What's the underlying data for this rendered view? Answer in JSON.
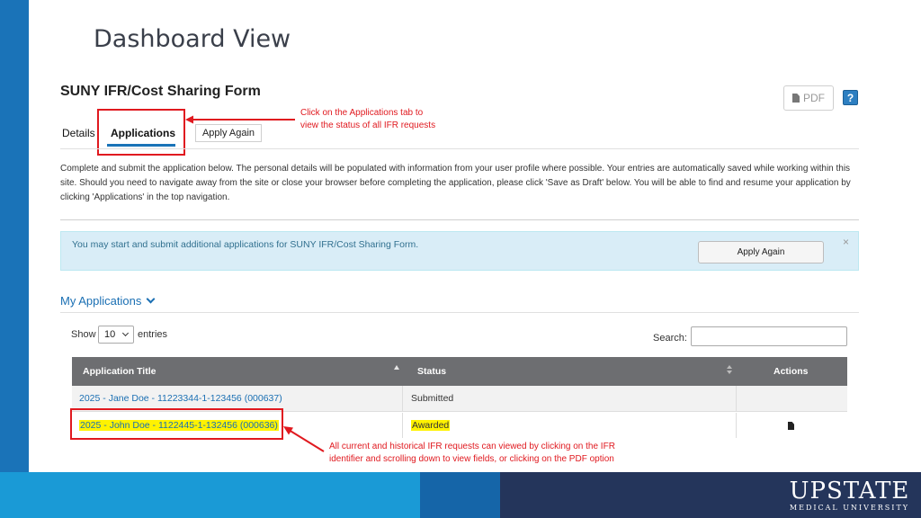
{
  "slide": {
    "title": "Dashboard View"
  },
  "form": {
    "title": "SUNY IFR/Cost Sharing Form",
    "pdf_label": "PDF",
    "help_label": "?"
  },
  "tabs": [
    {
      "label": "Details"
    },
    {
      "label": "Applications"
    }
  ],
  "apply_again_label": "Apply Again",
  "annotations": {
    "tab_callout_line1": "Click on the Applications tab to",
    "tab_callout_line2": "view the status of all IFR requests",
    "row_callout_line1": "All current and historical IFR requests can viewed by clicking on the IFR",
    "row_callout_line2": "identifier and scrolling down to view fields, or clicking on the PDF option"
  },
  "intro_text": "Complete and submit the application below. The personal details will be populated with information from your user profile where possible. Your entries are automatically saved while working within this site. Should you need to navigate away from the site or close your browser before completing the application, please click 'Save as Draft' below. You will be able to find and resume your application by clicking 'Applications' in the top navigation.",
  "info_panel": {
    "text": "You may start and submit additional applications for SUNY IFR/Cost Sharing Form.",
    "button_label": "Apply Again",
    "close_label": "×"
  },
  "my_applications": {
    "heading": "My Applications",
    "show_label": "Show",
    "entries_value": "10",
    "entries_label": "entries",
    "search_label": "Search:",
    "search_value": "",
    "columns": [
      "Application Title",
      "Status",
      "Actions"
    ],
    "rows": [
      {
        "title": "2025 - Jane Doe - 11223344-1-123456 (000637)",
        "status": "Submitted",
        "has_pdf": false
      },
      {
        "title": "2025 - John Doe - 1122445-1-132456 (000636)",
        "status": "Awarded",
        "has_pdf": true
      }
    ]
  },
  "logo": {
    "main": "UPSTATE",
    "sub": "MEDICAL UNIVERSITY"
  },
  "colors": {
    "accent_blue": "#1a73b8",
    "annotation_red": "#e0191f",
    "highlight_yellow": "#fff200",
    "table_header": "#6d6e71",
    "info_panel": "#d9edf7",
    "footer_navy": "#24355b"
  },
  "icons": {
    "pdf": "document-icon",
    "help": "question-icon",
    "chevron": "chevron-down-icon",
    "sort": "sort-icon",
    "close": "close-icon"
  }
}
